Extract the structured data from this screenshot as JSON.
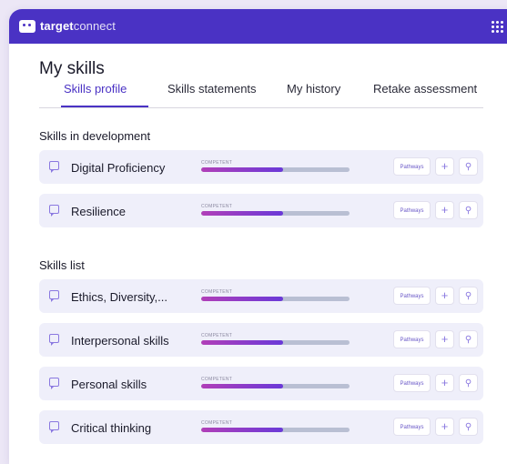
{
  "app": {
    "brand_bold": "target",
    "brand_light": "connect"
  },
  "page": {
    "title": "My skills"
  },
  "tabs": [
    {
      "label": "Skills profile",
      "active": true
    },
    {
      "label": "Skills statements",
      "active": false
    },
    {
      "label": "My history",
      "active": false
    },
    {
      "label": "Retake assessment",
      "active": false
    }
  ],
  "sections": {
    "development": {
      "title": "Skills in development",
      "items": [
        {
          "name": "Digital Proficiency",
          "level": "COMPETENT",
          "progress_percent": 55
        },
        {
          "name": "Resilience",
          "level": "COMPETENT",
          "progress_percent": 55
        }
      ]
    },
    "list": {
      "title": "Skills list",
      "items": [
        {
          "name": "Ethics, Diversity,...",
          "level": "COMPETENT",
          "progress_percent": 55
        },
        {
          "name": "Interpersonal skills",
          "level": "COMPETENT",
          "progress_percent": 55
        },
        {
          "name": "Personal skills",
          "level": "COMPETENT",
          "progress_percent": 55
        },
        {
          "name": "Critical thinking",
          "level": "COMPETENT",
          "progress_percent": 55
        }
      ]
    }
  },
  "actions": {
    "pathways_label": "Pathways",
    "add_symbol": "+",
    "pin_symbol": "⚲"
  },
  "icons": {
    "logo": "targetconnect-logo-icon",
    "apps": "grid-dots-icon",
    "comment": "comment-icon",
    "add": "plus-icon",
    "pin": "pin-icon"
  },
  "colors": {
    "brand": "#4a32c4",
    "card_bg": "#efeffa",
    "bar_start": "#b13fb8",
    "bar_end": "#6a39d8",
    "bar_track": "#b9bfd3"
  }
}
